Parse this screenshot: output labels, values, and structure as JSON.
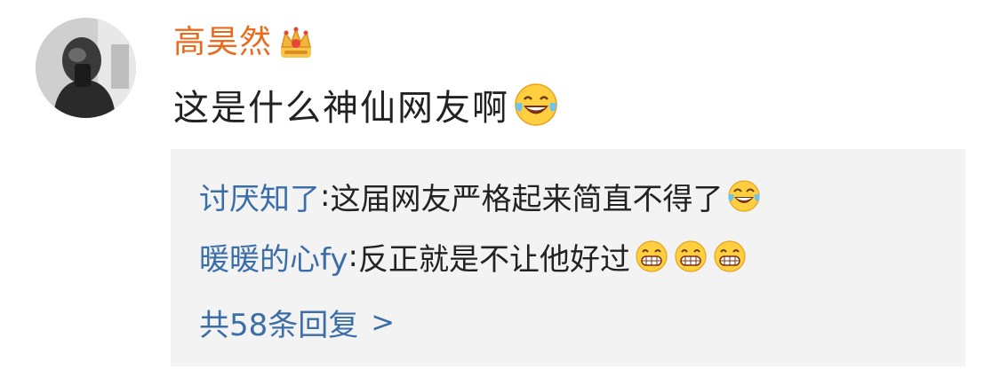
{
  "comment": {
    "author": "高昊然",
    "author_badge_icon": "crown-badge-icon",
    "text": "这是什么神仙网友啊",
    "text_emoji_icon": "laughing-tears-emoji-icon",
    "author_color": "#e86b1f"
  },
  "replies": [
    {
      "user": "讨厌知了",
      "separator": ": ",
      "text": "这届网友严格起来简直不得了",
      "emoji_icons": [
        "laughing-tears-emoji-icon"
      ]
    },
    {
      "user": "暖暖的心fy",
      "separator": ": ",
      "text": "反正就是不让他好过",
      "emoji_icons": [
        "grinning-emoji-icon",
        "grinning-emoji-icon",
        "grinning-emoji-icon"
      ]
    }
  ],
  "more_replies": {
    "label": "共58条回复",
    "chevron": ">"
  },
  "colors": {
    "link_blue": "#3b6ea8",
    "reply_background": "#f3f3f3",
    "text": "#222222"
  }
}
